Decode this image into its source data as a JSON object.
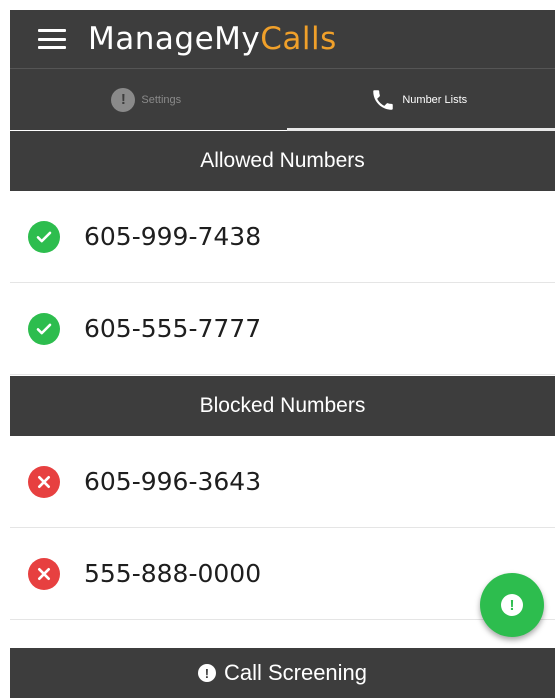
{
  "app": {
    "title_part1": "ManageMy",
    "title_part2": "Calls",
    "accent_color": "#f0a02a"
  },
  "tabs": [
    {
      "label": "Settings",
      "icon": "exclamation-circle-icon",
      "active": false
    },
    {
      "label": "Number Lists",
      "icon": "phone-icon",
      "active": true
    }
  ],
  "allowed": {
    "header": "Allowed Numbers",
    "numbers": [
      "605-999-7438",
      "605-555-7777"
    ],
    "icon": "check-circle-icon",
    "color": "#2dbd4e"
  },
  "blocked": {
    "header": "Blocked Numbers",
    "numbers": [
      "605-996-3643",
      "555-888-0000"
    ],
    "icon": "x-circle-icon",
    "color": "#e74040"
  },
  "fab": {
    "icon": "exclamation-icon",
    "glyph": "!"
  },
  "bottom_bar": {
    "label": "Call Screening",
    "icon": "exclamation-circle-icon",
    "glyph": "!"
  }
}
